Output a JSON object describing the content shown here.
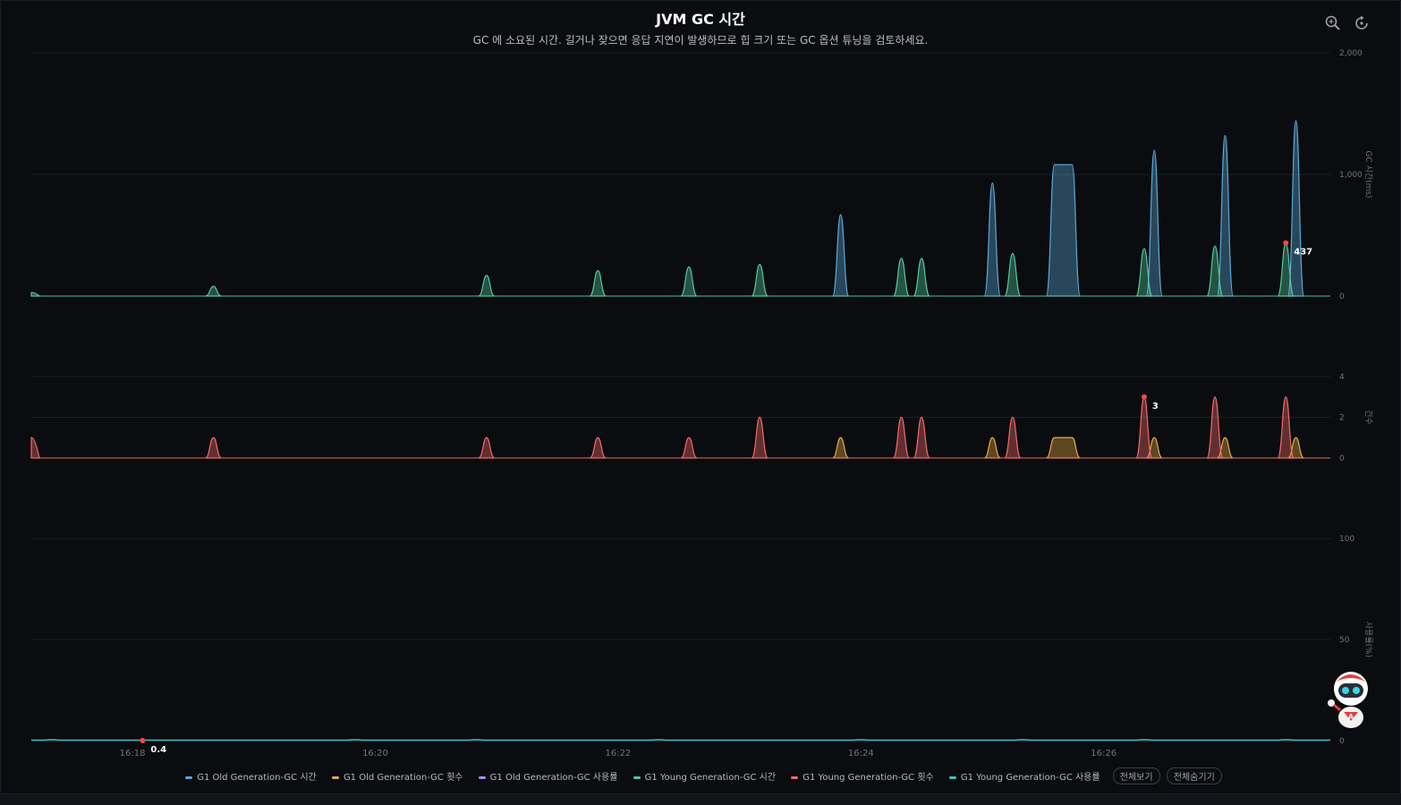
{
  "header": {
    "title": "JVM GC 시간",
    "subtitle": "GC 에 소요된 시간. 길거나 잦으면 응답 지연이 발생하므로 힙 크기 또는 GC 옵션 튜닝을 검토하세요."
  },
  "toolbar": {
    "zoom_icon": "zoom-icon",
    "reset_icon": "restore-icon"
  },
  "colors": {
    "old_time": "#5aa7d8",
    "old_count": "#e8a944",
    "old_usage": "#a78bfa",
    "young_time": "#52c79a",
    "young_count": "#f2686a",
    "young_usage": "#3fc1c9",
    "grid": "#1b1f24",
    "axis_text": "#6f757d"
  },
  "legend": {
    "items": [
      {
        "label": "G1 Old Generation-GC 시간",
        "color": "#5aa7d8"
      },
      {
        "label": "G1 Old Generation-GC 횟수",
        "color": "#e8a944"
      },
      {
        "label": "G1 Old Generation-GC 사용률",
        "color": "#a78bfa"
      },
      {
        "label": "G1 Young Generation-GC 시간",
        "color": "#52c79a"
      },
      {
        "label": "G1 Young Generation-GC 횟수",
        "color": "#f2686a"
      },
      {
        "label": "G1 Young Generation-GC 사용률",
        "color": "#3fc1c9"
      }
    ],
    "show_all": "전체보기",
    "hide_all": "전체숨기기"
  },
  "chart_data": {
    "type": "area",
    "x_axis": {
      "type": "time",
      "start": "16:17:10",
      "end": "16:27:52",
      "ticks": [
        "16:18",
        "16:20",
        "16:22",
        "16:24",
        "16:26"
      ]
    },
    "panels": [
      {
        "id": "time",
        "ylabel": "GC 시간(ms)",
        "ylim": [
          0,
          2000
        ],
        "yticks": [
          "0",
          "1,000",
          "2,000"
        ],
        "series": [
          {
            "name": "G1 Old Generation-GC 시간",
            "color": "#5aa7d8",
            "points": [
              [
                "16:23:50",
                670
              ],
              [
                "16:25:05",
                930
              ],
              [
                "16:25:40",
                1080,
                10
              ],
              [
                "16:26:25",
                1200
              ],
              [
                "16:27:00",
                1320
              ],
              [
                "16:27:35",
                1440
              ]
            ]
          },
          {
            "name": "G1 Young Generation-GC 시간",
            "color": "#52c79a",
            "points": [
              [
                "16:17:10",
                30
              ],
              [
                "16:18:40",
                80
              ],
              [
                "16:20:55",
                170
              ],
              [
                "16:21:50",
                210
              ],
              [
                "16:22:35",
                240
              ],
              [
                "16:23:10",
                260
              ],
              [
                "16:24:20",
                310
              ],
              [
                "16:24:30",
                310
              ],
              [
                "16:25:15",
                350
              ],
              [
                "16:26:20",
                390
              ],
              [
                "16:26:55",
                410
              ],
              [
                "16:27:30",
                437
              ]
            ]
          }
        ],
        "marker": {
          "series": "G1 Young Generation-GC 시간",
          "x": "16:27:30",
          "label": "437"
        }
      },
      {
        "id": "count",
        "ylabel": "건수",
        "ylim": [
          0,
          4
        ],
        "yticks": [
          "0",
          "2",
          "4"
        ],
        "series": [
          {
            "name": "G1 Old Generation-GC 횟수",
            "color": "#e8a944",
            "points": [
              [
                "16:23:50",
                1
              ],
              [
                "16:25:05",
                1
              ],
              [
                "16:25:40",
                1,
                10
              ],
              [
                "16:26:25",
                1
              ],
              [
                "16:27:00",
                1
              ],
              [
                "16:27:35",
                1
              ]
            ]
          },
          {
            "name": "G1 Young Generation-GC 횟수",
            "color": "#f2686a",
            "points": [
              [
                "16:17:10",
                1
              ],
              [
                "16:18:40",
                1
              ],
              [
                "16:20:55",
                1
              ],
              [
                "16:21:50",
                1
              ],
              [
                "16:22:35",
                1
              ],
              [
                "16:23:10",
                2
              ],
              [
                "16:24:20",
                2
              ],
              [
                "16:24:30",
                2
              ],
              [
                "16:25:15",
                2
              ],
              [
                "16:26:20",
                3
              ],
              [
                "16:26:55",
                3
              ],
              [
                "16:27:30",
                3
              ]
            ]
          }
        ],
        "marker": {
          "series": "G1 Young Generation-GC 횟수",
          "x": "16:26:20",
          "label": "3"
        }
      },
      {
        "id": "usage",
        "ylabel": "사용률(%)",
        "ylim": [
          0,
          100
        ],
        "yticks": [
          "0",
          "50",
          "100"
        ],
        "series": [
          {
            "name": "G1 Old Generation-GC 사용률",
            "color": "#a78bfa",
            "points": []
          },
          {
            "name": "G1 Young Generation-GC 사용률",
            "color": "#3fc1c9",
            "points": [
              [
                "16:17:20",
                0.4
              ],
              [
                "16:19:50",
                0.4
              ],
              [
                "16:20:50",
                0.4
              ],
              [
                "16:22:20",
                0.4
              ],
              [
                "16:24:00",
                0.4
              ],
              [
                "16:25:20",
                0.4
              ],
              [
                "16:26:20",
                0.4
              ],
              [
                "16:27:30",
                0.4
              ]
            ]
          }
        ],
        "marker": {
          "series": "G1 Young Generation-GC 사용률",
          "x": "16:18:05",
          "label": "0.4"
        }
      }
    ]
  }
}
